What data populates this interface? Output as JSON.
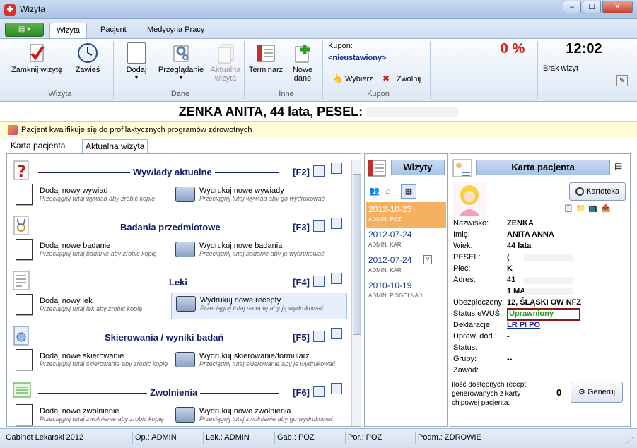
{
  "window": {
    "title": "Wizyta",
    "min": "–",
    "max": "☐",
    "close": "✕"
  },
  "ribbon_tabs": [
    "Wizyta",
    "Pacjent",
    "Medycyna Pracy"
  ],
  "ribbon": {
    "wizyta": {
      "close_visit": "Zamknij wizytę",
      "suspend": "Zawieś",
      "group": "Wizyta"
    },
    "dane": {
      "add": "Dodaj",
      "browse": "Przeglądanie",
      "update_line1": "Aktualna",
      "update_line2": "wizyta",
      "group": "Dane"
    },
    "inne": {
      "schedule": "Terminarz",
      "new_line1": "Nowe",
      "new_line2": "dane",
      "group": "Inne"
    },
    "kupon": {
      "label": "Kupon:",
      "value": "<nieustawiony>",
      "select": "Wybierz",
      "release": "Zwolnij",
      "group": "Kupon"
    },
    "percent": "0 %",
    "clock": "12:02",
    "no_visits": "Brak wizyt"
  },
  "patient": {
    "header": "ZENKA ANITA, 44 lata, PESEL:"
  },
  "info_bar": "Pacjent kwalifikuje się do profilaktycznych programów zdrowotnych",
  "patient_tabs": [
    "Karta pacjenta",
    "Aktualna wizyta"
  ],
  "sections": [
    {
      "title": "Wywiady aktualne",
      "key": "[F2]",
      "add": "Dodaj nowy wywiad",
      "add_hint": "Przeciągnij tutaj wywiad aby zrobić kopię",
      "print": "Wydrukuj nowe wywiady",
      "print_hint": "Przeciągnij tutaj wywiad aby go wydrukować"
    },
    {
      "title": "Badania przedmiotowe",
      "key": "[F3]",
      "add": "Dodaj nowe badanie",
      "add_hint": "Przeciągnij tutaj badanie aby zrobić kopię",
      "print": "Wydrukuj nowe badania",
      "print_hint": "Przeciągnij tutaj badanie aby je wydrukować"
    },
    {
      "title": "Leki",
      "key": "[F4]",
      "add": "Dodaj nowy lek",
      "add_hint": "Przeciągnij tutaj lek aby zrobić kopię",
      "print": "Wydrukuj nowe recepty",
      "print_hint": "Przeciągnij tutaj receptę aby ją wydrukować"
    },
    {
      "title": "Skierowania / wyniki badań",
      "key": "[F5]",
      "add": "Dodaj nowe skierowanie",
      "add_hint": "Przeciągnij tutaj skierowanie aby zrobić kopię",
      "print": "Wydrukuj skierowanie/formularz",
      "print_hint": "Przeciągnij tutaj skierowanie aby je wydrukować"
    },
    {
      "title": "Zwolnienia",
      "key": "[F6]",
      "add": "Dodaj nowe zwolnienie",
      "add_hint": "Przeciągnij tutaj zwolnienie aby zrobić kopię",
      "print": "Wydrukuj nowe zwolnienia",
      "print_hint": "Przeciągnij tutaj zwolnienie aby go wydrukować"
    }
  ],
  "visits": {
    "header": "Wizyty",
    "items": [
      {
        "date": "2012-10-23",
        "sub": "ADMIN, POZ"
      },
      {
        "date": "2012-07-24",
        "sub": "ADMIN, KAR"
      },
      {
        "date": "2012-07-24",
        "sub": "ADMIN, KAR"
      },
      {
        "date": "2010-10-19",
        "sub": "ADMIN, P.OGÓLNA 1"
      }
    ],
    "filter_icon": "Y"
  },
  "card": {
    "header": "Karta pacjenta",
    "kartoteka": "Kartoteka",
    "fields": [
      {
        "label": "Nazwisko:",
        "value": "ZENKA"
      },
      {
        "label": "Imię:",
        "value": "ANITA ANNA"
      },
      {
        "label": "Wiek:",
        "value": "44 lata"
      },
      {
        "label": "PESEL:",
        "value": "(",
        "masked": true
      },
      {
        "label": "Płeć:",
        "value": "K"
      },
      {
        "label": "Adres:",
        "value": "41",
        "masked": true
      },
      {
        "label": "",
        "value": "1 MAJA 1/2",
        "masked": true
      },
      {
        "label": "Ubezpieczony:",
        "value": "12, ŚLĄSKI OW NFZ"
      },
      {
        "label": "Status eWUŚ:",
        "value": "Uprawniony"
      },
      {
        "label": "Deklaracje:",
        "value": "LR PI PO"
      },
      {
        "label": "Upraw. dod.:",
        "value": "-"
      },
      {
        "label": "Status:",
        "value": ""
      },
      {
        "label": "Grupy:",
        "value": "--"
      },
      {
        "label": "Zawód:",
        "value": ""
      }
    ],
    "recipes_text_line1": "Ilość dostępnych recept",
    "recipes_text_line2": "generowanych z karty",
    "recipes_text_line3": "chipowej pacjenta:",
    "recipes_count": "0",
    "generate": "Generuj"
  },
  "statusbar": [
    "Gabinet Lekarski 2012",
    "Op.: ADMIN",
    "Lek.: ADMIN",
    "Gab.: POZ",
    "Por.: POZ",
    "Podm.: ZDROWIE"
  ]
}
